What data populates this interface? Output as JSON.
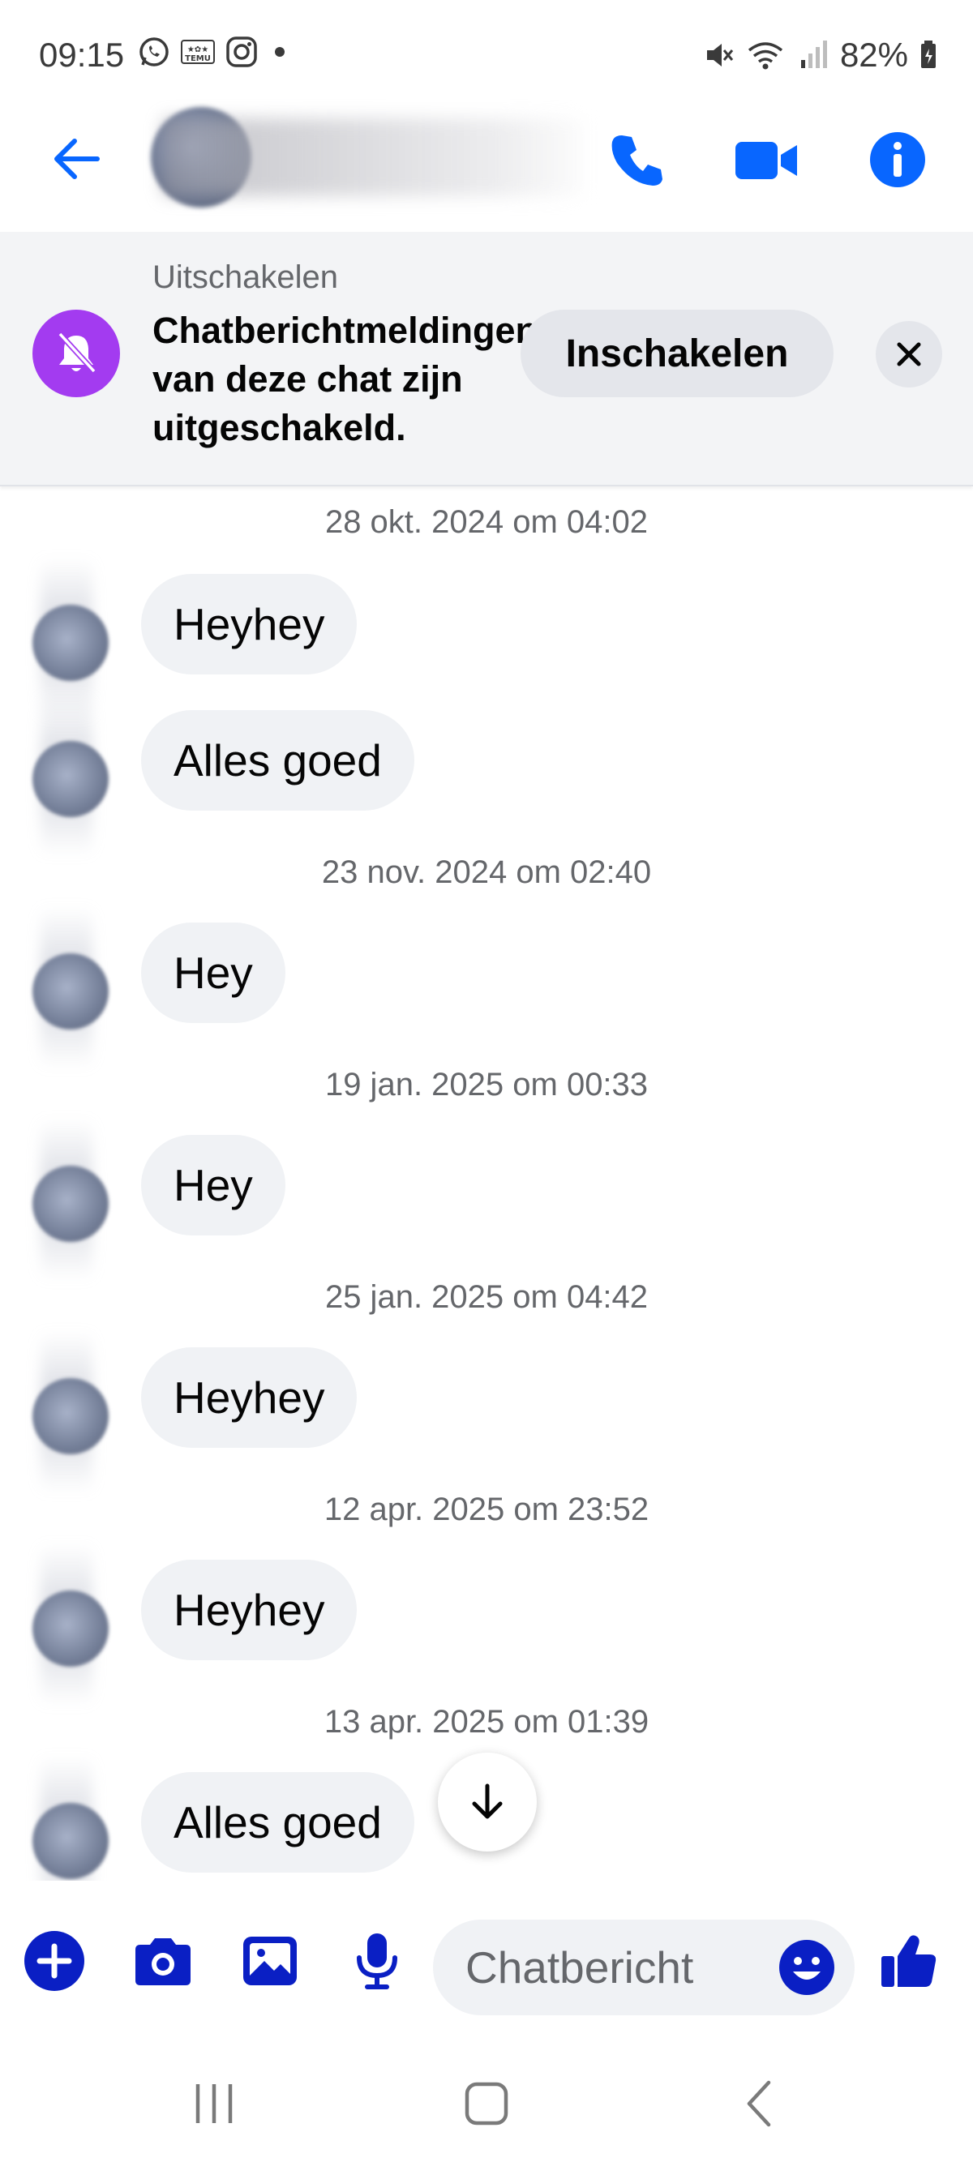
{
  "status_bar": {
    "time": "09:15",
    "battery": "82%",
    "left_icons": [
      "whatsapp-icon",
      "temu-icon",
      "instagram-icon",
      "dot-icon"
    ],
    "right_icons": [
      "mute-icon",
      "wifi-icon",
      "signal-icon",
      "battery-icon"
    ]
  },
  "header": {
    "contact_name": "",
    "icons": [
      "back-arrow-icon",
      "phone-icon",
      "video-camera-icon",
      "info-icon"
    ],
    "accent_color": "#0866ff"
  },
  "mute_banner": {
    "title": "Uitschakelen",
    "message": "Chatberichtmeldingen van deze chat zijn uitgeschakeld.",
    "enable_button": "Inschakelen",
    "icon": "bell-off-icon",
    "icon_color": "#a33bf0"
  },
  "messages": [
    {
      "timestamp": "28 okt. 2024 om 04:02",
      "texts": [
        "Heyhey",
        "Alles goed"
      ]
    },
    {
      "timestamp": "23 nov. 2024 om 02:40",
      "texts": [
        "Hey"
      ]
    },
    {
      "timestamp": "19 jan. 2025 om 00:33",
      "texts": [
        "Hey"
      ]
    },
    {
      "timestamp": "25 jan. 2025 om 04:42",
      "texts": [
        "Heyhey"
      ]
    },
    {
      "timestamp": "12 apr. 2025 om 23:52",
      "texts": [
        "Heyhey"
      ]
    },
    {
      "timestamp": "13 apr. 2025 om 01:39",
      "texts": [
        "Alles goed"
      ]
    }
  ],
  "composer": {
    "placeholder": "Chatbericht",
    "icons": [
      "plus-icon",
      "camera-icon",
      "gallery-icon",
      "microphone-icon",
      "emoji-icon",
      "thumbs-up-icon"
    ],
    "icon_color": "#0a1fc4"
  },
  "nav_bar": {
    "icons": [
      "recent-apps-icon",
      "home-icon",
      "back-icon"
    ]
  }
}
